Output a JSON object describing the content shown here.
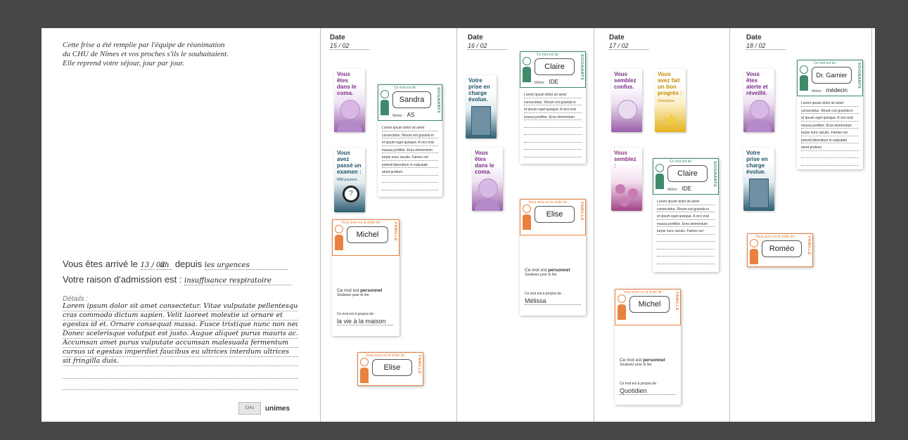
{
  "intro": [
    "Cette frise a été remplie par l'équipe de réanimation",
    "du CHU de Nîmes et vos proches s'ils le souhaitaient.",
    "Elle reprend votre séjour, jour par jour."
  ],
  "arrival": {
    "prefix": "Vous êtes arrivé le",
    "date": "13 / 02",
    "time": "8h",
    "depuis": "depuis",
    "origin": "les urgences"
  },
  "admission": {
    "prefix": "Votre raison d'admission est :",
    "reason": "insuffisance respiratoire"
  },
  "details": {
    "label": "Détails :",
    "lines": [
      "Lorem ipsum dolor sit amet consectetur. Vitae vulputate pellentesque",
      "cras commodo dictum sapien. Velit laoreet molestie ut ornare et",
      "egestas id et. Ornare consequat massa. Fusce tristique nunc non nec.",
      "Donec scelerisque volutpat est justo. Augue aliquet purus mauris ac.",
      "Accumsan amet purus vulputate accumsan malesuada fermentum",
      "cursus ut egestas imperdiet faucibus eu ultrices interdum ultrices",
      "sit fringilla duis."
    ]
  },
  "logos": {
    "chu": "CHU",
    "univ": "unimes"
  },
  "columns": [
    {
      "label": "Date",
      "date": "15 / 02"
    },
    {
      "label": "Date",
      "date": "16 / 02"
    },
    {
      "label": "Date",
      "date": "17 / 02"
    },
    {
      "label": "Date",
      "date": "18 / 02"
    }
  ],
  "moods": {
    "coma": "Vous êtes dans le coma.",
    "examen": "Vous avez passé un examen :",
    "examen_detail": "IRM poumon",
    "prise_charge": "Votre prise en charge évolue.",
    "coma2": "Vous êtes dans le coma.",
    "confus": "Vous semblez confus.",
    "progres": "Vous avez fait un bon progrès :",
    "progres_detail": "Dénutrition",
    "semblez": "Vous semblez :",
    "alerte": "Vous êtes alerte et réveillé.",
    "prise_charge2": "Votre prise en charge évolue."
  },
  "soignant_cards": {
    "header": "Ce mot est de :",
    "side": "SOIGNANTS",
    "metier_label": "Métier :",
    "lorem": [
      "Lorem ipsum dolor sit amet",
      "consectetur. Rinum est gravida in",
      "et ipsum eget quisque. A orci erat",
      "massa porttitor. Eros elementum",
      "turpis nunc iaculis. Fames est",
      "potenti bibendum in vulputate",
      "amet pretium."
    ],
    "items": [
      {
        "name": "Sandra",
        "metier": "AS"
      },
      {
        "name": "Claire",
        "metier": "IDE"
      },
      {
        "name": "Claire",
        "metier": "IDE"
      },
      {
        "name": "Dr. Garnier",
        "metier": "médecin"
      }
    ]
  },
  "famille_cards": {
    "header": "Vous avez eu la visite de :",
    "side": "FAMILLE",
    "perso_prefix": "Ce mot est",
    "perso_word": "personnel",
    "perso_hint": "Soulevez pour le lire.",
    "apropos_label": "Ce mot est à propos de :",
    "items": [
      {
        "name": "Michel",
        "about": "la vie à la maison"
      },
      {
        "name": "Elise",
        "about": ""
      },
      {
        "name": "Elise",
        "about": "Mélissa"
      },
      {
        "name": "Michel",
        "about": "Quotidien"
      },
      {
        "name": "Roméo",
        "about": ""
      }
    ]
  }
}
